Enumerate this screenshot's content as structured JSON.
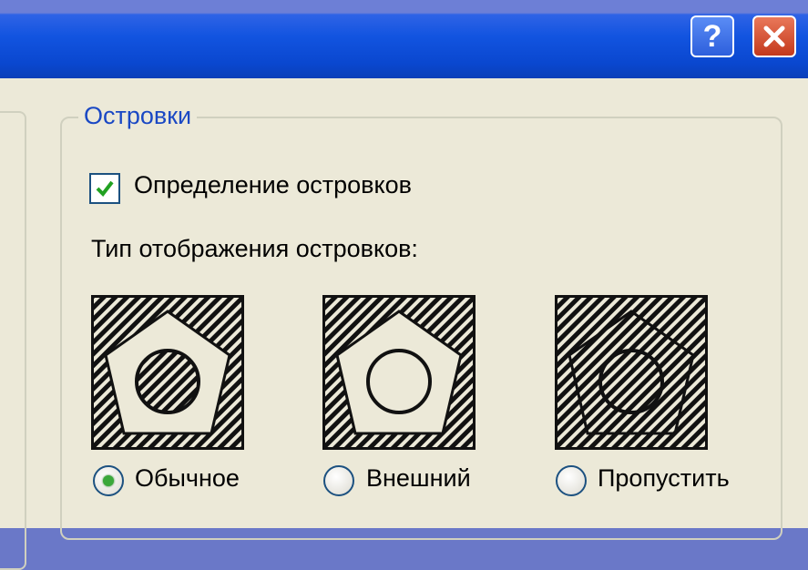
{
  "title_bar": {
    "help_icon": "question-mark-icon",
    "close_icon": "close-x-icon"
  },
  "islands_group": {
    "title": "Островки",
    "detect_checkbox": {
      "label": "Определение островков",
      "checked": true
    },
    "display_type_label": "Тип отображения островков:",
    "options": [
      {
        "label": "Обычное",
        "selected": true,
        "preview": "normal-island-preview"
      },
      {
        "label": "Внешний",
        "selected": false,
        "preview": "outer-island-preview"
      },
      {
        "label": "Пропустить",
        "selected": false,
        "preview": "ignore-island-preview"
      }
    ]
  },
  "colors": {
    "titlebar": "#0a47cf",
    "dialog_bg": "#ece9d8",
    "group_title": "#1a48c4",
    "close_button": "#c4391c",
    "help_button": "#2d5fdc",
    "checkmark": "#21a121"
  }
}
